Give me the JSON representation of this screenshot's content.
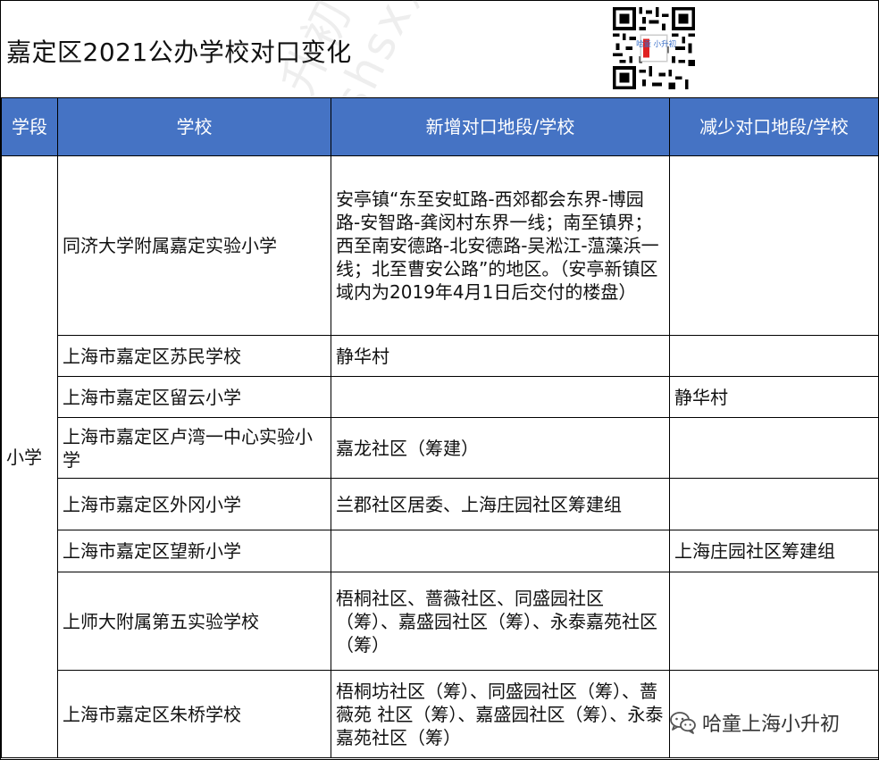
{
  "title": "嘉定区2021公办学校对口变化",
  "qr_icon": "qr-code-icon",
  "qr_text": "哈童 小升初",
  "table": {
    "headers": [
      "学段",
      "学校",
      "新增对口地段/学校",
      "减少对口地段/学校"
    ],
    "stage": "小学",
    "rows": [
      {
        "school": "同济大学附属嘉定实验小学",
        "added": "安亭镇“东至安虹路-西郊都会东界-博园路-安智路-龚闵村东界一线；南至镇界；西至南安德路-北安德路-吴淞江-蕰藻浜一线；北至曹安公路”的地区。（安亭新镇区域内为2019年4月1日后交付的楼盘）",
        "removed": ""
      },
      {
        "school": "上海市嘉定区苏民学校",
        "added": "静华村",
        "removed": ""
      },
      {
        "school": "上海市嘉定区留云小学",
        "added": "",
        "removed": "静华村"
      },
      {
        "school": "上海市嘉定区卢湾一中心实验小学",
        "added": "嘉龙社区（筹建）",
        "removed": ""
      },
      {
        "school": "上海市嘉定区外冈小学",
        "added": "兰郡社区居委、上海庄园社区筹建组",
        "removed": ""
      },
      {
        "school": "上海市嘉定区望新小学",
        "added": "",
        "removed": "上海庄园社区筹建组"
      },
      {
        "school": "上师大附属第五实验学校",
        "added": "梧桐社区、蔷薇社区、同盛园社区（筹）、嘉盛园社区（筹）、永泰嘉苑社区（筹）",
        "removed": ""
      },
      {
        "school": "上海市嘉定区朱桥学校",
        "added": "梧桐坊社区（筹）、同盛园社区（筹）、蔷薇苑 社区（筹）、嘉盛园社区（筹）、永泰嘉苑社区（筹）",
        "removed": ""
      }
    ]
  },
  "watermark": {
    "line1": "哈童上海小升初",
    "line2": "（hatong-shsx）"
  },
  "brand": {
    "icon": "wechat-icon",
    "label": "哈童上海小升初"
  },
  "colors": {
    "header_bg": "#4573c4",
    "added_text": "#e00000",
    "removed_text": "#4aa03c"
  }
}
